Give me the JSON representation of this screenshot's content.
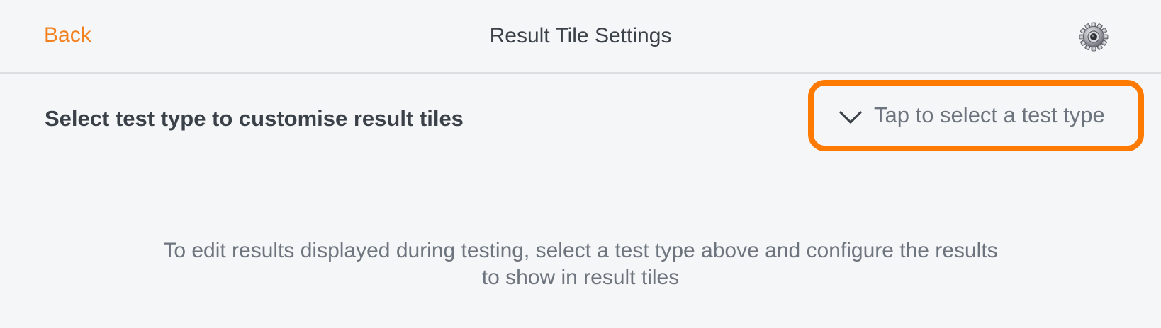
{
  "header": {
    "back_label": "Back",
    "title": "Result Tile Settings",
    "settings_icon": "gear-icon",
    "accent_color": "#f2801f"
  },
  "selector": {
    "label": "Select test type to customise result tiles",
    "placeholder": "Tap to select a test type",
    "icon": "chevron-down-icon",
    "highlight_color": "#ff7a00"
  },
  "info": {
    "line1": "To edit results displayed during testing, select a test type above and configure the results",
    "line2": "to show in result tiles"
  }
}
